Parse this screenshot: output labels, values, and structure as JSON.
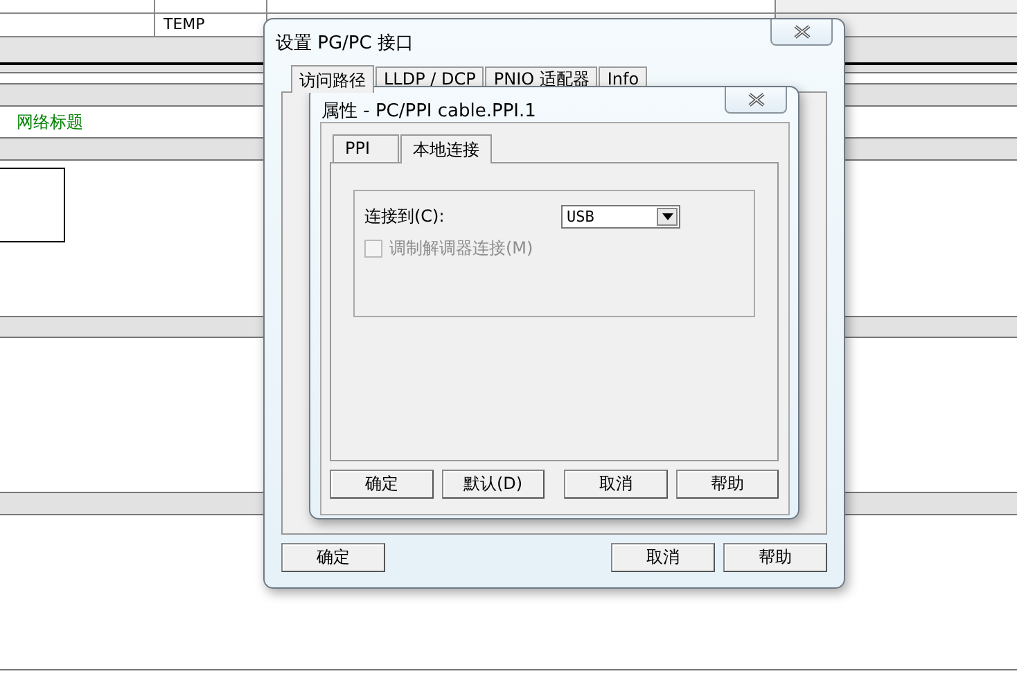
{
  "editor": {
    "temp_cell": "TEMP",
    "network_title": "网络标题"
  },
  "pgpc_dialog": {
    "title": "设置 PG/PC 接口",
    "tabs": [
      {
        "label": "访问路径",
        "selected": true
      },
      {
        "label": "LLDP / DCP",
        "selected": false
      },
      {
        "label": "PNIO 适配器",
        "selected": false
      },
      {
        "label": "Info",
        "selected": false
      }
    ],
    "buttons": [
      "确定",
      "取消",
      "帮助"
    ]
  },
  "properties_dialog": {
    "title": "属性 - PC/PPI cable.PPI.1",
    "tabs": [
      {
        "label": "PPI",
        "selected": false
      },
      {
        "label": "本地连接",
        "selected": true
      }
    ],
    "connect_label": "连接到(C):",
    "connect_value": "USB",
    "modem_checkbox": {
      "label": "调制解调器连接(M)",
      "checked": false,
      "disabled": true
    },
    "buttons": [
      "确定",
      "默认(D)",
      "取消",
      "帮助"
    ]
  }
}
